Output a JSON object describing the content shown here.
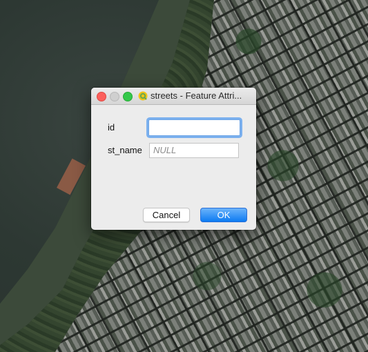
{
  "window": {
    "title": "streets - Feature Attri..."
  },
  "form": {
    "fields": [
      {
        "label": "id",
        "value": "",
        "placeholder": ""
      },
      {
        "label": "st_name",
        "value": "NULL"
      }
    ]
  },
  "buttons": {
    "cancel_label": "Cancel",
    "ok_label": "OK"
  },
  "colors": {
    "accent": "#1f80f4",
    "close": "#fc605c",
    "maximize": "#34c84a"
  },
  "icons": {
    "app": "qgis-logo-icon"
  }
}
